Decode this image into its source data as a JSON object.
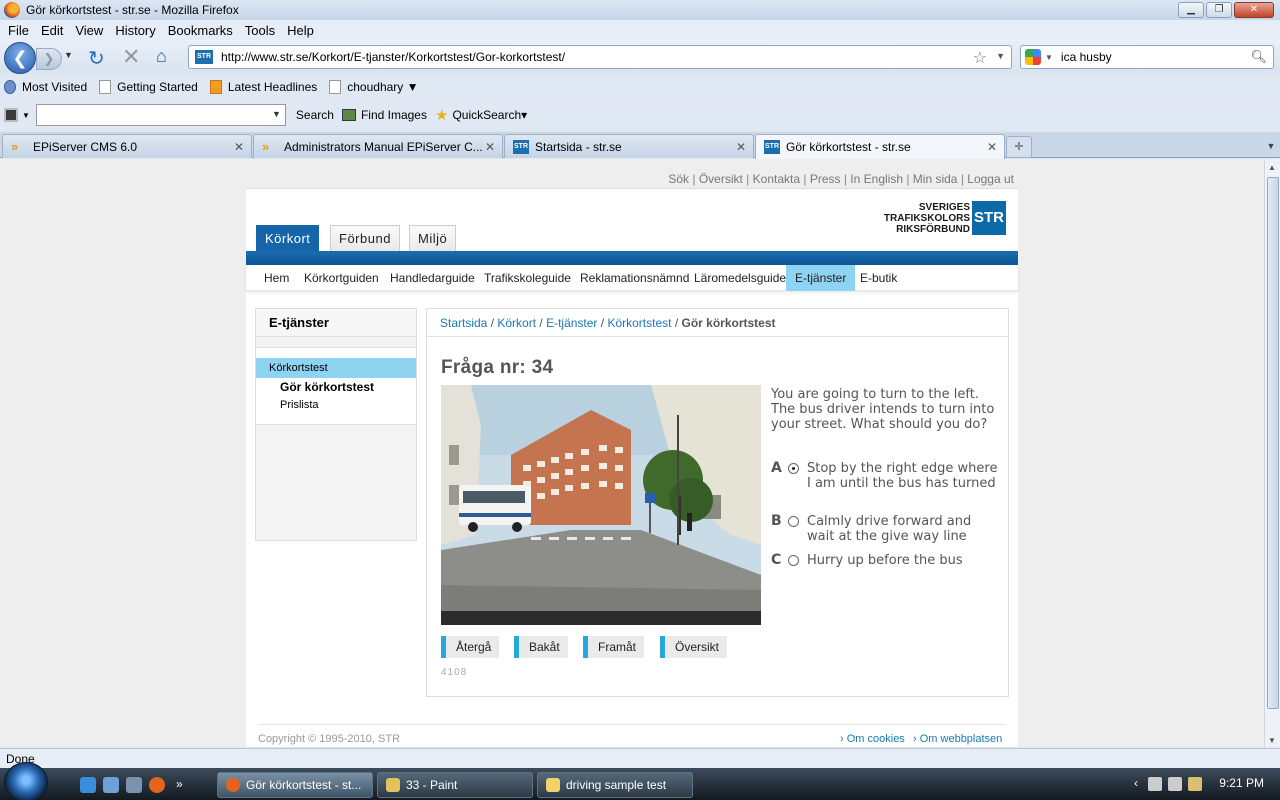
{
  "window": {
    "title": "Gör körkortstest - str.se - Mozilla Firefox"
  },
  "menu": [
    "File",
    "Edit",
    "View",
    "History",
    "Bookmarks",
    "Tools",
    "Help"
  ],
  "nav": {
    "url": "http://www.str.se/Korkort/E-tjanster/Korkortstest/Gor-korkortstest/",
    "search_value": "ica husby"
  },
  "bookmarks": [
    "Most Visited",
    "Getting Started",
    "Latest Headlines",
    "choudhary ▼"
  ],
  "toolbar2": {
    "search_label": "Search",
    "find_images_label": "Find Images",
    "quicksearch_label": "QuickSearch▾"
  },
  "tabs": [
    {
      "label": "EPiServer CMS 6.0",
      "active": false
    },
    {
      "label": "Administrators Manual EPiServer C...",
      "active": false
    },
    {
      "label": "Startsida - str.se",
      "active": false
    },
    {
      "label": "Gör körkortstest - str.se",
      "active": true
    }
  ],
  "site": {
    "top_links": [
      "Sök",
      "Översikt",
      "Kontakta",
      "Press",
      "In English",
      "Min sida",
      "Logga ut"
    ],
    "logo": {
      "line1": "SVERIGES",
      "line2": "TRAFIKSKOLORS",
      "line3": "RIKSFÖRBUND",
      "box": "STR"
    },
    "main_tabs": [
      "Körkort",
      "Förbund",
      "Miljö"
    ],
    "subnav": [
      "Hem",
      "Körkortguiden",
      "Handledarguide",
      "Trafikskoleguide",
      "Reklamationsnämnd",
      "Läromedelsguide",
      "E-tjänster",
      "E-butik"
    ],
    "sidebar": {
      "heading": "E-tjänster",
      "selected": "Körkortstest",
      "sub": [
        "Gör körkortstest",
        "Prislista"
      ]
    },
    "breadcrumb": [
      "Startsida",
      "Körkort",
      "E-tjänster",
      "Körkortstest",
      "Gör körkortstest"
    ],
    "question": {
      "title": "Fråga nr: 34",
      "text": "You are going to turn to the left. The bus driver intends to turn into your street. What should you do?",
      "answers": [
        {
          "letter": "A",
          "text": "Stop by the right edge where I am until the bus has turned",
          "selected": true
        },
        {
          "letter": "B",
          "text": "Calmly drive forward and wait at the give way line",
          "selected": false
        },
        {
          "letter": "C",
          "text": "Hurry up before the bus",
          "selected": false
        }
      ],
      "buttons": [
        "Återgå",
        "Bakåt",
        "Framåt",
        "Översikt"
      ],
      "id": "4108"
    },
    "footer": {
      "copyright": "Copyright © 1995-2010, STR",
      "links": [
        "Om cookies",
        "Om webbplatsen"
      ]
    }
  },
  "status": "Done",
  "taskbar": {
    "items": [
      "Gör körkortstest - st...",
      "33 - Paint",
      "driving sample test"
    ],
    "clock": "9:21 PM"
  }
}
